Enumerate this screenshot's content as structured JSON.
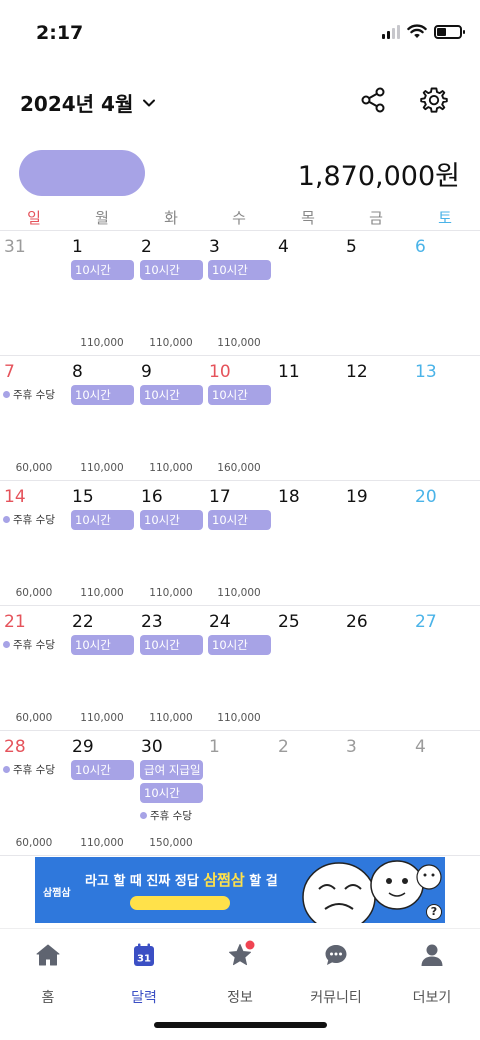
{
  "status_bar": {
    "time": "2:17",
    "icons": [
      "cellular-signal-icon",
      "wifi-icon",
      "battery-icon"
    ]
  },
  "header": {
    "month_title": "2024년 4월",
    "icons": [
      "chevron-down-icon",
      "share-icon",
      "gear-icon"
    ]
  },
  "summary": {
    "total": "1,870,000원"
  },
  "weekdays": [
    "일",
    "월",
    "화",
    "수",
    "목",
    "금",
    "토"
  ],
  "calendar": {
    "weeks": [
      {
        "days": [
          {
            "num": "31",
            "faded": true
          },
          {
            "num": "1",
            "chip": "10시간"
          },
          {
            "num": "2",
            "chip": "10시간"
          },
          {
            "num": "3",
            "chip": "10시간"
          },
          {
            "num": "4"
          },
          {
            "num": "5"
          },
          {
            "num": "6"
          }
        ],
        "amounts": [
          "",
          "110,000",
          "110,000",
          "110,000",
          "",
          "",
          ""
        ]
      },
      {
        "days": [
          {
            "num": "7",
            "allowance": "주휴 수당"
          },
          {
            "num": "8",
            "chip": "10시간"
          },
          {
            "num": "9",
            "chip": "10시간"
          },
          {
            "num": "10",
            "chip": "10시간",
            "holiday": true
          },
          {
            "num": "11"
          },
          {
            "num": "12"
          },
          {
            "num": "13"
          }
        ],
        "amounts": [
          "60,000",
          "110,000",
          "110,000",
          "160,000",
          "",
          "",
          ""
        ]
      },
      {
        "days": [
          {
            "num": "14",
            "allowance": "주휴 수당"
          },
          {
            "num": "15",
            "chip": "10시간"
          },
          {
            "num": "16",
            "chip": "10시간"
          },
          {
            "num": "17",
            "chip": "10시간"
          },
          {
            "num": "18"
          },
          {
            "num": "19"
          },
          {
            "num": "20"
          }
        ],
        "amounts": [
          "60,000",
          "110,000",
          "110,000",
          "110,000",
          "",
          "",
          ""
        ]
      },
      {
        "days": [
          {
            "num": "21",
            "allowance": "주휴 수당"
          },
          {
            "num": "22",
            "chip": "10시간"
          },
          {
            "num": "23",
            "chip": "10시간"
          },
          {
            "num": "24",
            "chip": "10시간"
          },
          {
            "num": "25"
          },
          {
            "num": "26"
          },
          {
            "num": "27"
          }
        ],
        "amounts": [
          "60,000",
          "110,000",
          "110,000",
          "110,000",
          "",
          "",
          ""
        ]
      },
      {
        "days": [
          {
            "num": "28",
            "allowance": "주휴 수당"
          },
          {
            "num": "29",
            "chip": "10시간"
          },
          {
            "num": "30",
            "payday": "급여 지급일",
            "chip": "10시간",
            "allowance": "주휴 수당"
          },
          {
            "num": "1",
            "faded": true
          },
          {
            "num": "2",
            "faded": true
          },
          {
            "num": "3",
            "faded": true
          },
          {
            "num": "4",
            "faded": true
          }
        ],
        "amounts": [
          "60,000",
          "110,000",
          "150,000",
          "",
          "",
          "",
          ""
        ]
      }
    ]
  },
  "ad": {
    "logo": "삼쩜삼",
    "headline_a": "라고 할 때 진짜 정답",
    "headline_b": "삼쩜삼",
    "headline_c": "할 걸",
    "help": "?"
  },
  "tabbar": {
    "tabs": [
      {
        "label": "홈",
        "icon": "home-icon"
      },
      {
        "label": "달력",
        "icon": "calendar-icon",
        "icon_text": "31",
        "active": true
      },
      {
        "label": "정보",
        "icon": "star-icon",
        "badge": true
      },
      {
        "label": "커뮤니티",
        "icon": "chat-bubble-icon"
      },
      {
        "label": "더보기",
        "icon": "person-icon"
      }
    ]
  },
  "colors": {
    "accent": "#a7a3e6",
    "sunday": "#e5535b",
    "saturday": "#4ab3e8",
    "active_tab": "#3b4fc4",
    "badge": "#f04452",
    "ad_blue": "#2f78dc",
    "ad_yellow": "#ffe14a"
  }
}
